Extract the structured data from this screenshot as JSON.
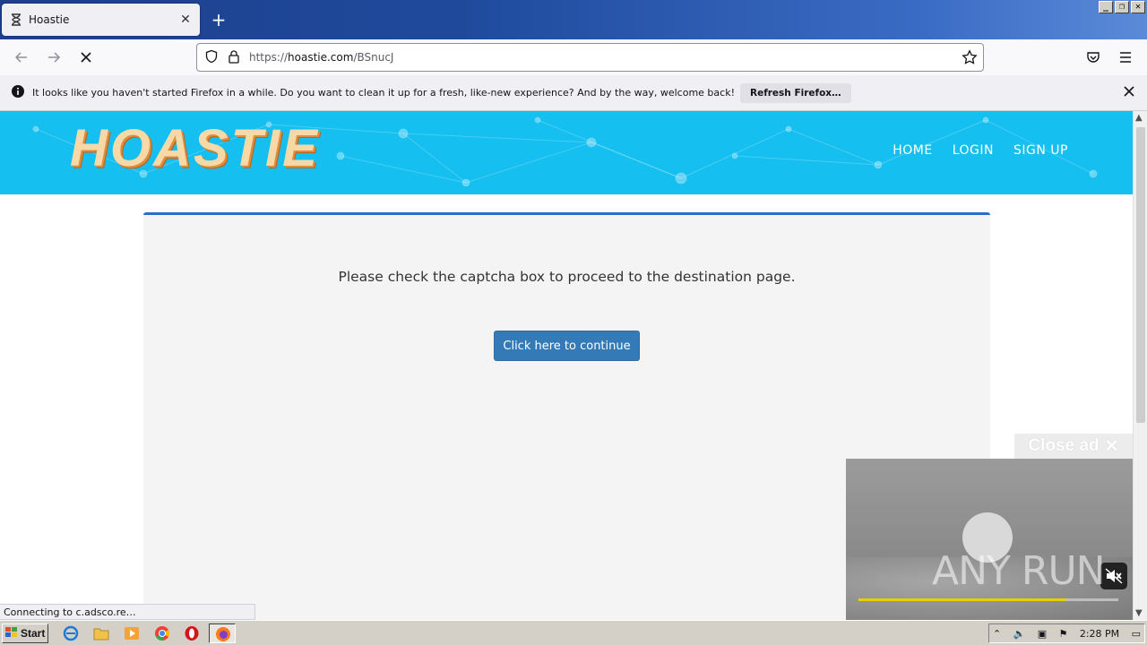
{
  "browser": {
    "tab_title": "Hoastie",
    "url_prefix": "https://",
    "url_host": "hoastie.com",
    "url_path": "/BSnucJ",
    "notification_text": "It looks like you haven't started Firefox in a while. Do you want to clean it up for a fresh, like-new experience? And by the way, welcome back!",
    "notification_button": "Refresh Firefox…",
    "status_text": "Connecting to c.adsco.re…"
  },
  "site": {
    "logo": "HOASTIE",
    "nav": [
      "HOME",
      "LOGIN",
      "SIGN UP"
    ],
    "prompt": "Please check the captcha box to proceed to the destination page.",
    "continue_label": "Click here to continue"
  },
  "ad": {
    "close_label": "Close ad",
    "watermark": "ANY RUN",
    "progress": 0.8
  },
  "taskbar": {
    "start_label": "Start",
    "clock": "2:28 PM"
  },
  "colors": {
    "hero": "#15bff0",
    "card_border": "#2a6fc7",
    "button": "#337ab7"
  }
}
